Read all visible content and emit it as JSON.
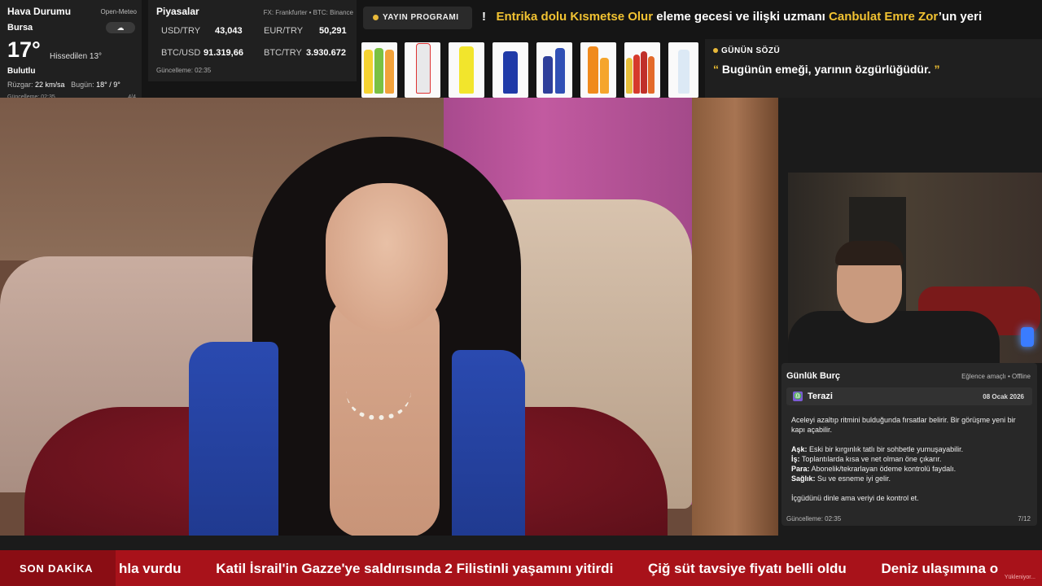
{
  "weather": {
    "title": "Hava Durumu",
    "source": "Open-Meteo",
    "city": "Bursa",
    "icon": "cloud-icon",
    "temp": "17°",
    "feels": "Hissedilen 13°",
    "condition": "Bulutlu",
    "wind_label": "Rüzgar:",
    "wind": "22 km/sa",
    "today_label": "Bugün:",
    "today": "18° / 9°",
    "updated": "Güncelleme: 02:35",
    "page": "4/4"
  },
  "markets": {
    "title": "Piyasalar",
    "source": "FX: Frankfurter • BTC: Binance",
    "rows": [
      {
        "label": "USD/TRY",
        "value": "43,043"
      },
      {
        "label": "EUR/TRY",
        "value": "50,291"
      },
      {
        "label": "BTC/USD",
        "value": "91.319,66"
      },
      {
        "label": "BTC/TRY",
        "value": "3.930.672"
      }
    ],
    "updated": "Güncelleme: 02:35"
  },
  "schedule": {
    "label": "YAYIN PROGRAMI"
  },
  "top_ticker": {
    "lead": "!",
    "highlight1": "Entrika dolu Kısmetse Olur",
    "text1": " eleme gecesi ve ilişki uzmanı ",
    "highlight2": "Canbulat Emre Zor",
    "text2": "’un yeri"
  },
  "quote": {
    "title": "GÜNÜN SÖZÜ",
    "open": "“",
    "text": "Bugünün emeği, yarının özgürlüğüdür.",
    "close": "”"
  },
  "horoscope": {
    "title": "Günlük Burç",
    "meta": "Eğlence amaçlı • Offline",
    "sign_icon": "libra-icon",
    "sign": "Terazi",
    "date": "08 Ocak 2026",
    "intro": "Aceleyi azaltıp ritmini bulduğunda fırsatlar belirir. Bir görüşme yeni bir kapı açabilir.",
    "love_label": "Aşk:",
    "love": " Eski bir kırgınlık tatlı bir sohbetle yumuşayabilir.",
    "work_label": "İş:",
    "work": " Toplantılarda kısa ve net olman öne çıkarır.",
    "money_label": "Para:",
    "money": " Abonelik/tekrarlayan ödeme kontrolü faydalı.",
    "health_label": "Sağlık:",
    "health": " Su ve esneme iyi gelir.",
    "closing": "İçgüdünü dinle ama veriyi de kontrol et.",
    "updated": "Güncelleme: 02:35",
    "page": "7/12"
  },
  "news": {
    "label": "SON DAKİKA",
    "items": [
      "hla vurdu",
      "Katil İsrail'in Gazze'ye saldırısında 2 Filistinli yaşamını yitirdi",
      "Çiğ süt tavsiye fiyatı belli oldu",
      "Deniz ulaşımına o"
    ],
    "loading": "Yükleniyor..."
  },
  "colors": {
    "accent": "#f1c232",
    "news_bg": "#a8121a",
    "panel": "#202020"
  }
}
